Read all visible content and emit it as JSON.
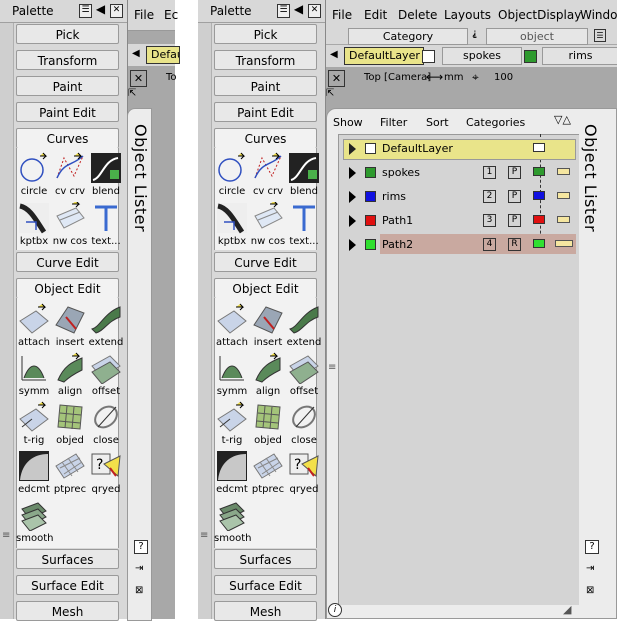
{
  "palette": {
    "title": "Palette",
    "tabs": {
      "pick": "Pick",
      "transform": "Transform",
      "paint": "Paint",
      "paint_edit": "Paint Edit",
      "curves": "Curves",
      "curve_edit": "Curve Edit",
      "object_edit": "Object Edit",
      "surfaces": "Surfaces",
      "surface_edit": "Surface Edit",
      "mesh": "Mesh"
    },
    "curve_tools": [
      "circle",
      "cv crv",
      "blend",
      "kptbx",
      "nw cos",
      "text..."
    ],
    "object_edit_tools": [
      "attach",
      "insert",
      "extend",
      "symm",
      "align",
      "offset",
      "t-rig",
      "objed",
      "close",
      "edcmt",
      "ptprec",
      "qryed",
      "smooth"
    ]
  },
  "menu": {
    "file": "File",
    "edit": "Edit",
    "edit_partial": "Ec",
    "delete": "Delete",
    "layouts": "Layouts",
    "object_display": "ObjectDisplay",
    "windows_partial": "Window"
  },
  "toolbar": {
    "category": "Category",
    "object": "object",
    "layer_default": "DefaultLayer",
    "layer_default_partial": "Defau",
    "layer_spokes": "spokes",
    "layer_rims": "rims",
    "viewport_prefix_partial": "To",
    "viewport_label": "Top [Camera]",
    "units": "mm",
    "grid_value": "100"
  },
  "lister": {
    "title": "Object Lister",
    "menus": [
      "Show",
      "Filter",
      "Sort",
      "Categories"
    ],
    "rows": [
      {
        "name": "DefaultLayer",
        "num": "",
        "flag": "",
        "color": "#ffffff",
        "highlight": "#e9e48a"
      },
      {
        "name": "spokes",
        "num": "1",
        "flag": "P",
        "color": "#2e9a2e",
        "highlight": ""
      },
      {
        "name": "rims",
        "num": "2",
        "flag": "P",
        "color": "#1010e0",
        "highlight": ""
      },
      {
        "name": "Path1",
        "num": "3",
        "flag": "P",
        "color": "#e01010",
        "highlight": ""
      },
      {
        "name": "Path2",
        "num": "4",
        "flag": "R",
        "color": "#30e030",
        "highlight": "#c9a9a0"
      }
    ]
  }
}
